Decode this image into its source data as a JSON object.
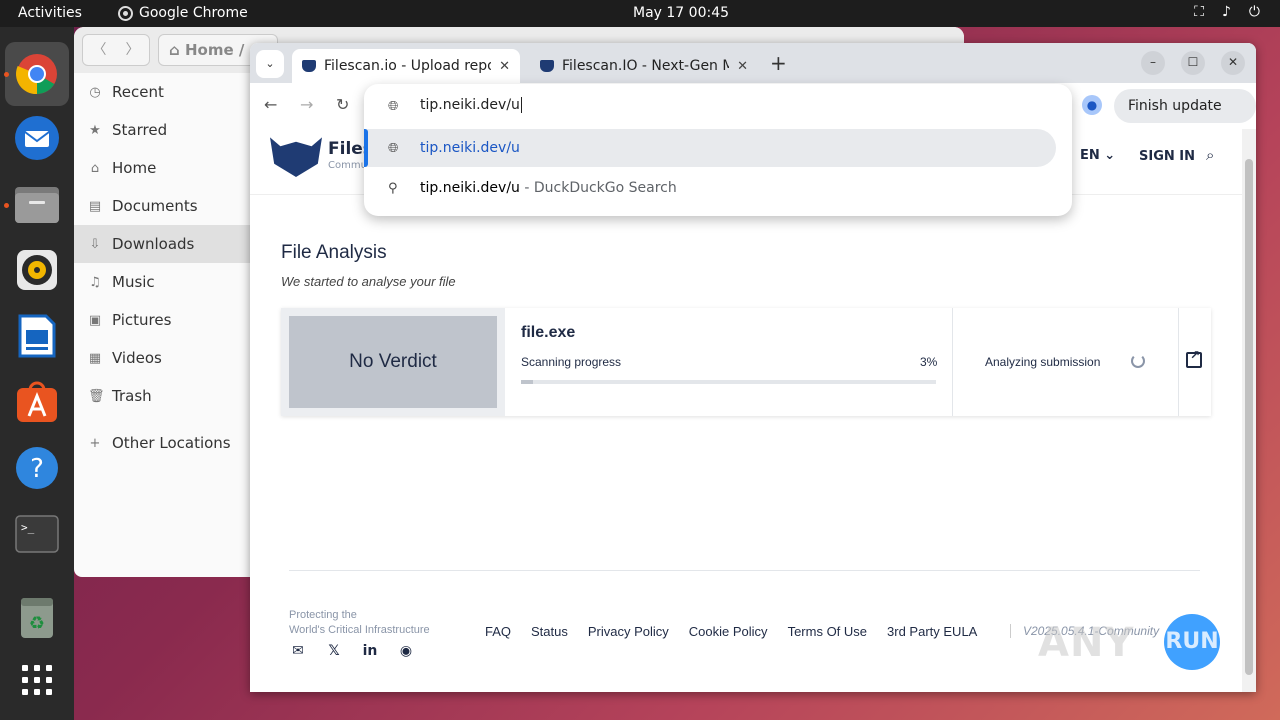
{
  "topbar": {
    "activities": "Activities",
    "app_name": "Google Chrome",
    "clock": "May 17  00:45"
  },
  "dock": {
    "items": [
      "chrome-icon",
      "thunderbird-icon",
      "files-icon",
      "rhythmbox-icon",
      "writer-icon",
      "appcenter-icon",
      "help-icon",
      "terminal-icon",
      "trash-icon",
      "apps-grid-icon"
    ]
  },
  "files": {
    "path_label": "Home",
    "sidebar": [
      {
        "label": "Recent",
        "icon": "clock-icon"
      },
      {
        "label": "Starred",
        "icon": "star-icon"
      },
      {
        "label": "Home",
        "icon": "home-icon"
      },
      {
        "label": "Documents",
        "icon": "document-icon"
      },
      {
        "label": "Downloads",
        "icon": "download-icon"
      },
      {
        "label": "Music",
        "icon": "music-icon"
      },
      {
        "label": "Pictures",
        "icon": "picture-icon"
      },
      {
        "label": "Videos",
        "icon": "video-icon"
      },
      {
        "label": "Trash",
        "icon": "trash-icon"
      },
      {
        "label": "Other Locations",
        "icon": "plus-icon"
      }
    ]
  },
  "chrome": {
    "tabs": [
      {
        "title": "Filescan.io - Upload repo",
        "active": true
      },
      {
        "title": "Filescan.IO - Next-Gen M",
        "active": false
      }
    ],
    "finish_update": "Finish update",
    "omnibox": {
      "input": "tip.neiki.dev/u",
      "suggestions": [
        {
          "url": "tip.neiki.dev/u",
          "suffix": "",
          "icon": "globe-icon"
        },
        {
          "url": "tip.neiki.dev/u",
          "suffix": " - DuckDuckGo Search",
          "icon": "search-icon"
        }
      ]
    }
  },
  "site": {
    "logo_text": "Files",
    "logo_sub": "Commu",
    "lang": "EN",
    "sign_in": "SIGN IN",
    "title": "File Analysis",
    "subtitle": "We started to analyse your file",
    "card": {
      "verdict": "No Verdict",
      "file_name": "file.exe",
      "progress_label": "Scanning progress",
      "progress_text": "3%",
      "progress_value": 0.03,
      "status": "Analyzing submission"
    },
    "footer": {
      "tagline_1": "Protecting the",
      "tagline_2": "World's Critical Infrastructure",
      "links": [
        "FAQ",
        "Status",
        "Privacy Policy",
        "Cookie Policy",
        "Terms Of Use",
        "3rd Party EULA"
      ],
      "version": "V2025.05.4.1-Community"
    }
  },
  "watermark": {
    "left": "ANY",
    "right": "RUN"
  }
}
